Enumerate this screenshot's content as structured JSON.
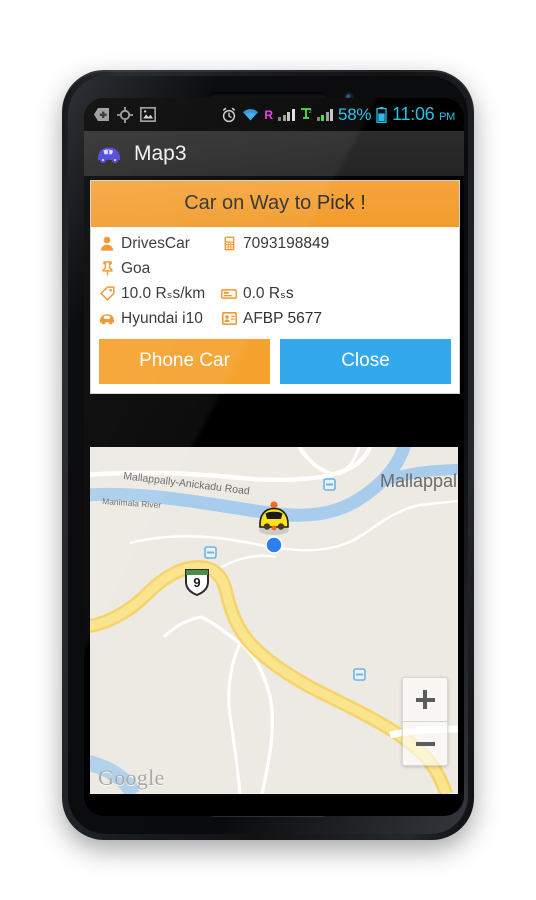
{
  "statusbar": {
    "notifications": [
      {
        "name": "plus-badge-icon"
      },
      {
        "name": "gps-crosshair-icon"
      },
      {
        "name": "image-icon"
      }
    ],
    "alarm_icon": "alarm-icon",
    "wifi_icon": "wifi-icon",
    "roaming_label": "R",
    "sim2_label": "T",
    "sim2_superscript": "2",
    "battery_percent": "58%",
    "battery_icon": "battery-icon",
    "time": "11:06",
    "meridiem": "PM",
    "colors": {
      "roaming": "#e832e8",
      "sim2": "#39e639",
      "battery_text": "#29c0e8",
      "clock": "#29c0e8"
    }
  },
  "actionbar": {
    "app_icon": "car-app-icon",
    "title": "Map3"
  },
  "card": {
    "header": "Car on Way to Pick !",
    "rows": [
      [
        {
          "icon": "person-icon",
          "text": "DrivesCar"
        },
        {
          "icon": "phone-icon",
          "text": "7093198849"
        }
      ],
      [
        {
          "icon": "pin-icon",
          "text": "Goa"
        }
      ],
      [
        {
          "icon": "tag-icon",
          "text": "10.0 Rₛs/km"
        },
        {
          "icon": "ticket-icon",
          "text": "0.0 Rₛs"
        }
      ],
      [
        {
          "icon": "car-icon",
          "text": "Hyundai i10"
        },
        {
          "icon": "id-card-icon",
          "text": "AFBP 5677"
        }
      ]
    ],
    "buttons": [
      {
        "label": "Phone Car",
        "name": "phone-car-button",
        "color": "#f5a22f"
      },
      {
        "label": "Close",
        "name": "close-button",
        "color": "#34a8ec"
      }
    ],
    "colors": {
      "header_bg": "#f29c2c",
      "header_text": "#2e2e2e",
      "icon": "#ef9327"
    }
  },
  "map": {
    "labels": {
      "road": "Mallappally-Anickadu Road",
      "river": "Manimala River",
      "town": "Mallappally",
      "highway_shield": "9"
    },
    "markers": {
      "car_marker": "taxi-car-marker",
      "user_location": "blue-location-dot"
    },
    "zoom_controls": {
      "zoom_in": "+",
      "zoom_out": "−"
    },
    "attribution": "Google",
    "colors": {
      "land": "#eceae3",
      "water": "#a8cdec",
      "highway": "#fbde6f",
      "minor_road": "#ffffff",
      "marker_yellow": "#fbe215",
      "location_blue": "#2d7ff0"
    }
  }
}
